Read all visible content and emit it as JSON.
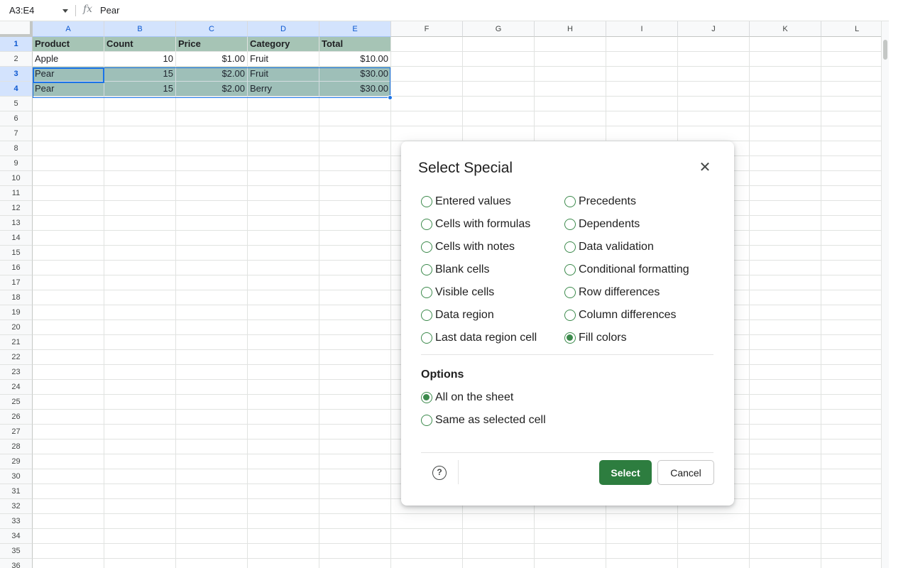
{
  "formula_bar": {
    "name_box": "A3:E4",
    "fx": "fx",
    "value": "Pear"
  },
  "columns": [
    "A",
    "B",
    "C",
    "D",
    "E",
    "F",
    "G",
    "H",
    "I",
    "J",
    "K",
    "L"
  ],
  "rows": [
    "1",
    "2",
    "3",
    "4",
    "5",
    "6",
    "7",
    "8",
    "9",
    "10",
    "11",
    "12",
    "13",
    "14",
    "15",
    "16",
    "17",
    "18",
    "19",
    "20",
    "21",
    "22",
    "23",
    "24",
    "25",
    "26",
    "27",
    "28",
    "29",
    "30",
    "31",
    "32",
    "33",
    "34",
    "35",
    "36"
  ],
  "table": {
    "headers": [
      "Product",
      "Count",
      "Price",
      "Category",
      "Total"
    ],
    "data": [
      [
        "Apple",
        "10",
        "$1.00",
        "Fruit",
        "$10.00"
      ],
      [
        "Pear",
        "15",
        "$2.00",
        "Fruit",
        "$30.00"
      ],
      [
        "Pear",
        "15",
        "$2.00",
        "Berry",
        "$30.00"
      ]
    ]
  },
  "colors": {
    "fill_color": "#a6c4b5",
    "accent": "#2d7d3f",
    "selection": "#1a73e8"
  },
  "dialog": {
    "title": "Select Special",
    "close_icon": "close-icon",
    "left_options": [
      "Entered values",
      "Cells with formulas",
      "Cells with notes",
      "Blank cells",
      "Visible cells",
      "Data region",
      "Last data region cell"
    ],
    "right_options": [
      "Precedents",
      "Dependents",
      "Data validation",
      "Conditional formatting",
      "Row differences",
      "Column differences",
      "Fill colors"
    ],
    "selected_option": "Fill colors",
    "options_heading": "Options",
    "scope_options": [
      "All on the sheet",
      "Same as selected cell"
    ],
    "selected_scope": "All on the sheet",
    "help_icon": "help-icon",
    "help_symbol": "?",
    "select_label": "Select",
    "cancel_label": "Cancel"
  }
}
